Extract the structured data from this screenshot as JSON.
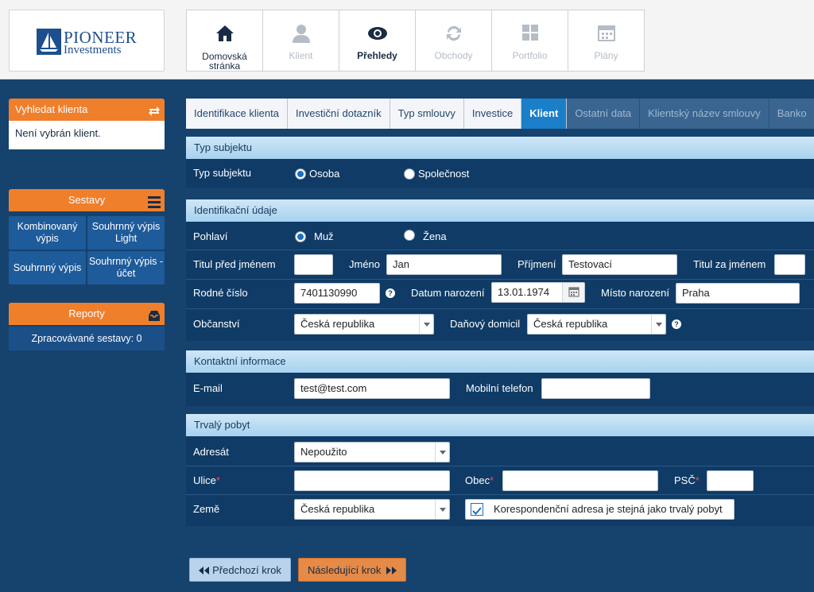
{
  "logo": {
    "line1": "PIONEER",
    "line2": "Investments"
  },
  "nav": [
    {
      "label": "Domovská stránka",
      "icon": "home-icon",
      "state": "active"
    },
    {
      "label": "Klient",
      "icon": "user-icon",
      "state": "disabled"
    },
    {
      "label": "Přehledy",
      "icon": "eye-icon",
      "state": "active"
    },
    {
      "label": "Obchody",
      "icon": "refresh-icon",
      "state": "disabled"
    },
    {
      "label": "Portfolio",
      "icon": "grid-icon",
      "state": "disabled"
    },
    {
      "label": "Plány",
      "icon": "calendar-icon",
      "state": "disabled"
    }
  ],
  "sidebar": {
    "search": {
      "title": "Vyhledat klienta",
      "body": "Není vybrán klient."
    },
    "sestavy": {
      "title": "Sestavy",
      "items": [
        "Kombinovaný výpis",
        "Souhrnný výpis Light",
        "Souhrnný výpis",
        "Souhrnný výpis - účet"
      ]
    },
    "reporty": {
      "title": "Reporty",
      "body": "Zpracovávané sestavy: 0"
    }
  },
  "wizard": {
    "steps": [
      "Identifikace klienta",
      "Investiční dotazník",
      "Typ smlouvy",
      "Investice",
      "Klient",
      "Ostatní data",
      "Klientský název smlouvy",
      "Banko"
    ],
    "active_index": 4
  },
  "sections": {
    "typ": {
      "title": "Typ subjektu",
      "label": "Typ subjektu",
      "opt1": "Osoba",
      "opt2": "Společnost",
      "selected": "Osoba"
    },
    "ident": {
      "title": "Identifikační údaje",
      "pohlavi": "Pohlaví",
      "muz": "Muž",
      "zena": "Žena",
      "selected": "Muž",
      "titul_pred": "Titul před jménem",
      "jmeno": "Jméno",
      "jmeno_val": "Jan",
      "prijmeni": "Příjmení",
      "prijmeni_val": "Testovací",
      "titul_za": "Titul za jménem",
      "rodne_cislo": "Rodné číslo",
      "rodne_cislo_val": "7401130990",
      "datum": "Datum narození",
      "datum_val": "13.01.1974",
      "misto": "Místo narození",
      "misto_val": "Praha",
      "obcanstvi": "Občanství",
      "obcanstvi_val": "Česká republika",
      "danovy": "Daňový domicil",
      "danovy_val": "Česká republika"
    },
    "kontakt": {
      "title": "Kontaktní informace",
      "email": "E-mail",
      "email_val": "test@test.com",
      "mobil": "Mobilní telefon"
    },
    "pobyt": {
      "title": "Trvalý pobyt",
      "adresat": "Adresát",
      "adresat_val": "Nepoužito",
      "ulice": "Ulice",
      "obec": "Obec",
      "psc": "PSČ",
      "zeme": "Země",
      "zeme_val": "Česká republika",
      "koresp": "Korespondenční adresa je stejná jako trvalý pobyt",
      "koresp_checked": true
    }
  },
  "buttons": {
    "prev": "Předchozí krok",
    "next": "Následující krok"
  },
  "colors": {
    "orange": "#f07f2c",
    "navy": "#16426e",
    "active_tab": "#1a7fc8"
  }
}
